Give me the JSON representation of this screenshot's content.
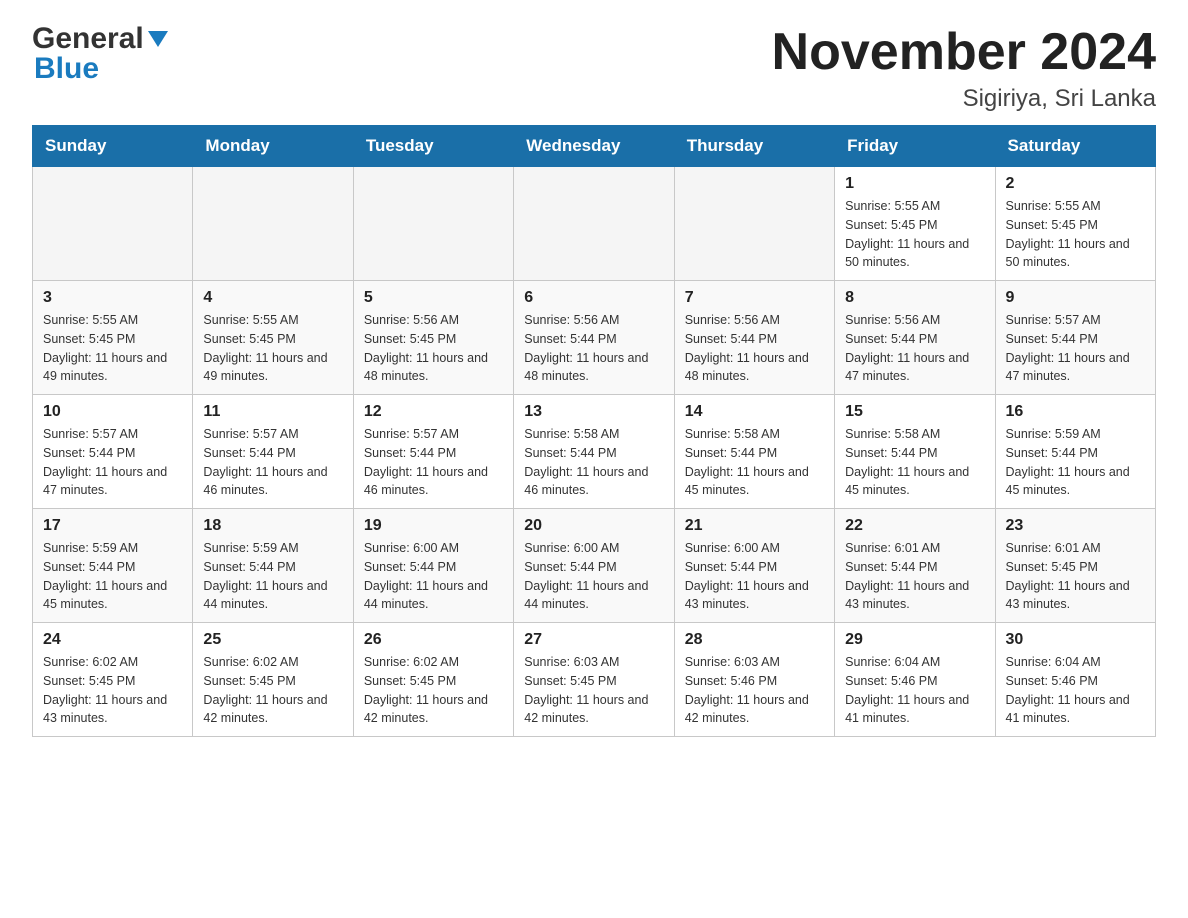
{
  "header": {
    "logo_general": "General",
    "logo_blue": "Blue",
    "title": "November 2024",
    "subtitle": "Sigiriya, Sri Lanka"
  },
  "weekdays": [
    "Sunday",
    "Monday",
    "Tuesday",
    "Wednesday",
    "Thursday",
    "Friday",
    "Saturday"
  ],
  "weeks": [
    [
      {
        "day": "",
        "info": ""
      },
      {
        "day": "",
        "info": ""
      },
      {
        "day": "",
        "info": ""
      },
      {
        "day": "",
        "info": ""
      },
      {
        "day": "",
        "info": ""
      },
      {
        "day": "1",
        "info": "Sunrise: 5:55 AM\nSunset: 5:45 PM\nDaylight: 11 hours and 50 minutes."
      },
      {
        "day": "2",
        "info": "Sunrise: 5:55 AM\nSunset: 5:45 PM\nDaylight: 11 hours and 50 minutes."
      }
    ],
    [
      {
        "day": "3",
        "info": "Sunrise: 5:55 AM\nSunset: 5:45 PM\nDaylight: 11 hours and 49 minutes."
      },
      {
        "day": "4",
        "info": "Sunrise: 5:55 AM\nSunset: 5:45 PM\nDaylight: 11 hours and 49 minutes."
      },
      {
        "day": "5",
        "info": "Sunrise: 5:56 AM\nSunset: 5:45 PM\nDaylight: 11 hours and 48 minutes."
      },
      {
        "day": "6",
        "info": "Sunrise: 5:56 AM\nSunset: 5:44 PM\nDaylight: 11 hours and 48 minutes."
      },
      {
        "day": "7",
        "info": "Sunrise: 5:56 AM\nSunset: 5:44 PM\nDaylight: 11 hours and 48 minutes."
      },
      {
        "day": "8",
        "info": "Sunrise: 5:56 AM\nSunset: 5:44 PM\nDaylight: 11 hours and 47 minutes."
      },
      {
        "day": "9",
        "info": "Sunrise: 5:57 AM\nSunset: 5:44 PM\nDaylight: 11 hours and 47 minutes."
      }
    ],
    [
      {
        "day": "10",
        "info": "Sunrise: 5:57 AM\nSunset: 5:44 PM\nDaylight: 11 hours and 47 minutes."
      },
      {
        "day": "11",
        "info": "Sunrise: 5:57 AM\nSunset: 5:44 PM\nDaylight: 11 hours and 46 minutes."
      },
      {
        "day": "12",
        "info": "Sunrise: 5:57 AM\nSunset: 5:44 PM\nDaylight: 11 hours and 46 minutes."
      },
      {
        "day": "13",
        "info": "Sunrise: 5:58 AM\nSunset: 5:44 PM\nDaylight: 11 hours and 46 minutes."
      },
      {
        "day": "14",
        "info": "Sunrise: 5:58 AM\nSunset: 5:44 PM\nDaylight: 11 hours and 45 minutes."
      },
      {
        "day": "15",
        "info": "Sunrise: 5:58 AM\nSunset: 5:44 PM\nDaylight: 11 hours and 45 minutes."
      },
      {
        "day": "16",
        "info": "Sunrise: 5:59 AM\nSunset: 5:44 PM\nDaylight: 11 hours and 45 minutes."
      }
    ],
    [
      {
        "day": "17",
        "info": "Sunrise: 5:59 AM\nSunset: 5:44 PM\nDaylight: 11 hours and 45 minutes."
      },
      {
        "day": "18",
        "info": "Sunrise: 5:59 AM\nSunset: 5:44 PM\nDaylight: 11 hours and 44 minutes."
      },
      {
        "day": "19",
        "info": "Sunrise: 6:00 AM\nSunset: 5:44 PM\nDaylight: 11 hours and 44 minutes."
      },
      {
        "day": "20",
        "info": "Sunrise: 6:00 AM\nSunset: 5:44 PM\nDaylight: 11 hours and 44 minutes."
      },
      {
        "day": "21",
        "info": "Sunrise: 6:00 AM\nSunset: 5:44 PM\nDaylight: 11 hours and 43 minutes."
      },
      {
        "day": "22",
        "info": "Sunrise: 6:01 AM\nSunset: 5:44 PM\nDaylight: 11 hours and 43 minutes."
      },
      {
        "day": "23",
        "info": "Sunrise: 6:01 AM\nSunset: 5:45 PM\nDaylight: 11 hours and 43 minutes."
      }
    ],
    [
      {
        "day": "24",
        "info": "Sunrise: 6:02 AM\nSunset: 5:45 PM\nDaylight: 11 hours and 43 minutes."
      },
      {
        "day": "25",
        "info": "Sunrise: 6:02 AM\nSunset: 5:45 PM\nDaylight: 11 hours and 42 minutes."
      },
      {
        "day": "26",
        "info": "Sunrise: 6:02 AM\nSunset: 5:45 PM\nDaylight: 11 hours and 42 minutes."
      },
      {
        "day": "27",
        "info": "Sunrise: 6:03 AM\nSunset: 5:45 PM\nDaylight: 11 hours and 42 minutes."
      },
      {
        "day": "28",
        "info": "Sunrise: 6:03 AM\nSunset: 5:46 PM\nDaylight: 11 hours and 42 minutes."
      },
      {
        "day": "29",
        "info": "Sunrise: 6:04 AM\nSunset: 5:46 PM\nDaylight: 11 hours and 41 minutes."
      },
      {
        "day": "30",
        "info": "Sunrise: 6:04 AM\nSunset: 5:46 PM\nDaylight: 11 hours and 41 minutes."
      }
    ]
  ]
}
